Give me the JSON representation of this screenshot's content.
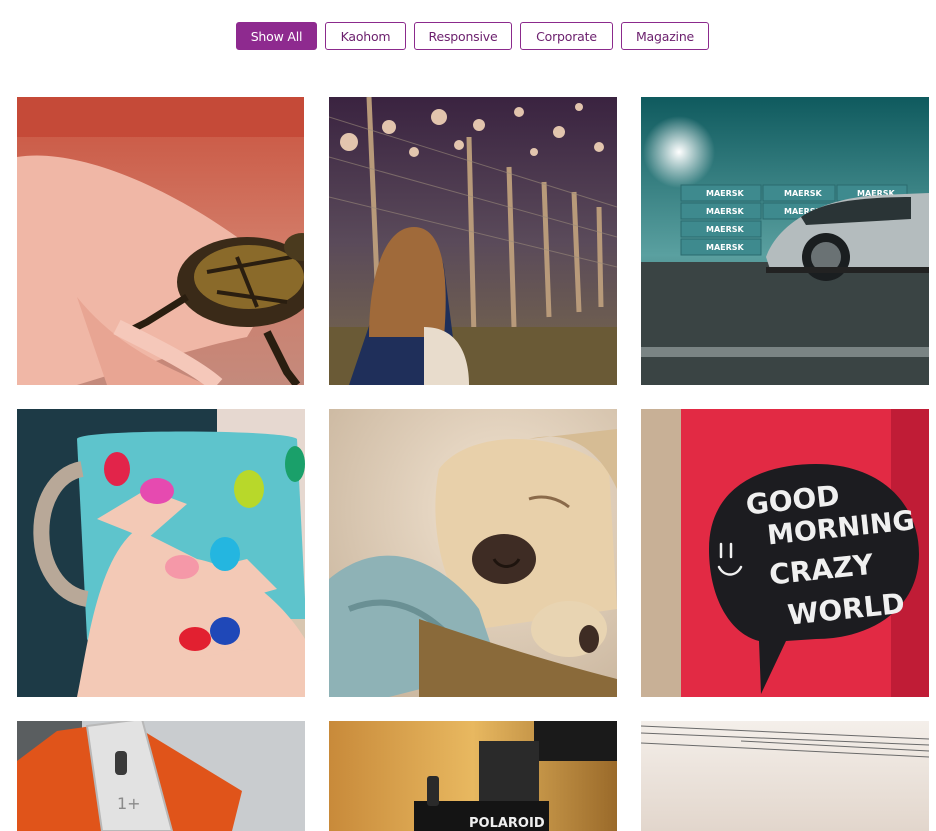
{
  "filters": [
    {
      "label": "Show All",
      "active": true
    },
    {
      "label": "Kaohom",
      "active": false
    },
    {
      "label": "Responsive",
      "active": false
    },
    {
      "label": "Corporate",
      "active": false
    },
    {
      "label": "Magazine",
      "active": false
    }
  ],
  "gallery": {
    "accent_color": "#8e2a8f",
    "items": [
      {
        "name": "turtle",
        "description": "hand holding small turtle"
      },
      {
        "name": "girl-fence",
        "description": "girl sitting by fence with bokeh lights"
      },
      {
        "name": "car-containers",
        "description": "silver car in front of shipping containers",
        "container_text": [
          "MAERSK",
          "MAERSK",
          "MAERSK",
          "MAERSK",
          "MAERSK",
          "MAERSK",
          "MAERSK"
        ]
      },
      {
        "name": "painted-nails",
        "description": "hands with colorful nails holding blue mug"
      },
      {
        "name": "sleeping-puppy",
        "description": "sleeping puppy on blanket"
      },
      {
        "name": "red-mug",
        "description": "red mug with chalk speech bubble",
        "mug_text": [
          "GOOD",
          "MORNING",
          "CRAZY",
          "WORLD"
        ]
      },
      {
        "name": "phone-notebook",
        "description": "phone on orange notebook",
        "phone_brand": "1+"
      },
      {
        "name": "polaroid",
        "description": "polaroid camera",
        "camera_text": "POLAROID"
      },
      {
        "name": "power-lines",
        "description": "sky with power lines"
      }
    ]
  }
}
